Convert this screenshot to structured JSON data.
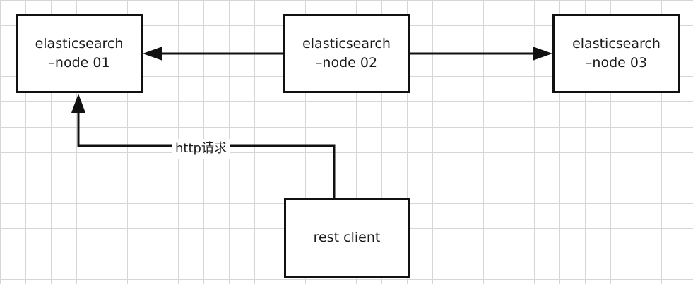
{
  "nodes": [
    {
      "id": "node01",
      "line1": "elasticsearch",
      "line2": "–node 01"
    },
    {
      "id": "node02",
      "line1": "elasticsearch",
      "line2": "–node 02"
    },
    {
      "id": "node03",
      "line1": "elasticsearch",
      "line2": "–node 03"
    },
    {
      "id": "client",
      "line1": "rest client"
    }
  ],
  "edges": [
    {
      "from": "elasticsearch –node 02",
      "to": "elasticsearch –node 01"
    },
    {
      "from": "elasticsearch –node 02",
      "to": "elasticsearch –node 03"
    },
    {
      "from": "rest client",
      "to": "elasticsearch –node 01",
      "label": "http请求"
    }
  ],
  "colors": {
    "line": "#111111",
    "grid": "#d6d6d6",
    "background": "#ffffff"
  }
}
